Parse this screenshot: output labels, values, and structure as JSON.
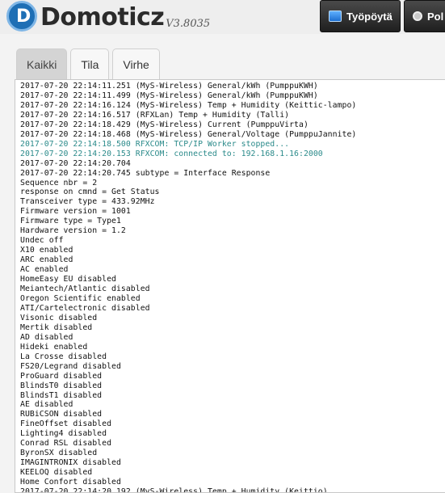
{
  "app": {
    "logo_text": "Domoticz",
    "version": "V3.8035"
  },
  "nav": {
    "dashboard_label": "Työpöytä",
    "other_label": "Pol"
  },
  "tabs": [
    {
      "label": "Kaikki",
      "active": true
    },
    {
      "label": "Tila",
      "active": false
    },
    {
      "label": "Virhe",
      "active": false
    }
  ],
  "colors": {
    "status_line": "#2a8a8a",
    "accent": "#1e6fb5"
  },
  "log_lines": [
    "2017-07-20 22:14:11.251 (MyS-Wireless) General/kWh (PumppuKWH)",
    "2017-07-20 22:14:11.499 (MyS-Wireless) General/kWh (PumppuKWH)",
    "2017-07-20 22:14:16.124 (MyS-Wireless) Temp + Humidity (Keittic-lampo)",
    "2017-07-20 22:14:16.517 (RFXLan) Temp + Humidity (Talli)",
    "2017-07-20 22:14:18.429 (MyS-Wireless) Current (PumppuVirta)",
    "2017-07-20 22:14:18.468 (MyS-Wireless) General/Voltage (PumppuJannite)",
    "2017-07-20 22:14:18.500 RFXCOM: TCP/IP Worker stopped...",
    "2017-07-20 22:14:20.153 RFXCOM: connected to: 192.168.1.16:2000",
    "2017-07-20 22:14:20.704",
    "2017-07-20 22:14:20.745 subtype = Interface Response",
    "Sequence nbr = 2",
    "response on cmnd = Get Status",
    "Transceiver type = 433.92MHz",
    "Firmware version = 1001",
    "Firmware type = Type1",
    "Hardware version = 1.2",
    "Undec off",
    "X10 enabled",
    "ARC enabled",
    "AC enabled",
    "HomeEasy EU disabled",
    "Meiantech/Atlantic disabled",
    "Oregon Scientific enabled",
    "ATI/Cartelectronic disabled",
    "Visonic disabled",
    "Mertik disabled",
    "AD disabled",
    "Hideki enabled",
    "La Crosse disabled",
    "FS20/Legrand disabled",
    "ProGuard disabled",
    "BlindsT0 disabled",
    "BlindsT1 disabled",
    "AE disabled",
    "RUBiCSON disabled",
    "FineOffset disabled",
    "Lighting4 disabled",
    "Conrad RSL disabled",
    "ByronSX disabled",
    "IMAGINTRONIX disabled",
    "KEELOQ disabled",
    "Home Confort disabled",
    "2017-07-20 22:14:20.192 (MyS-Wireless) Temp + Humidity (Keittio)"
  ],
  "status_line_indices": [
    6,
    7
  ]
}
